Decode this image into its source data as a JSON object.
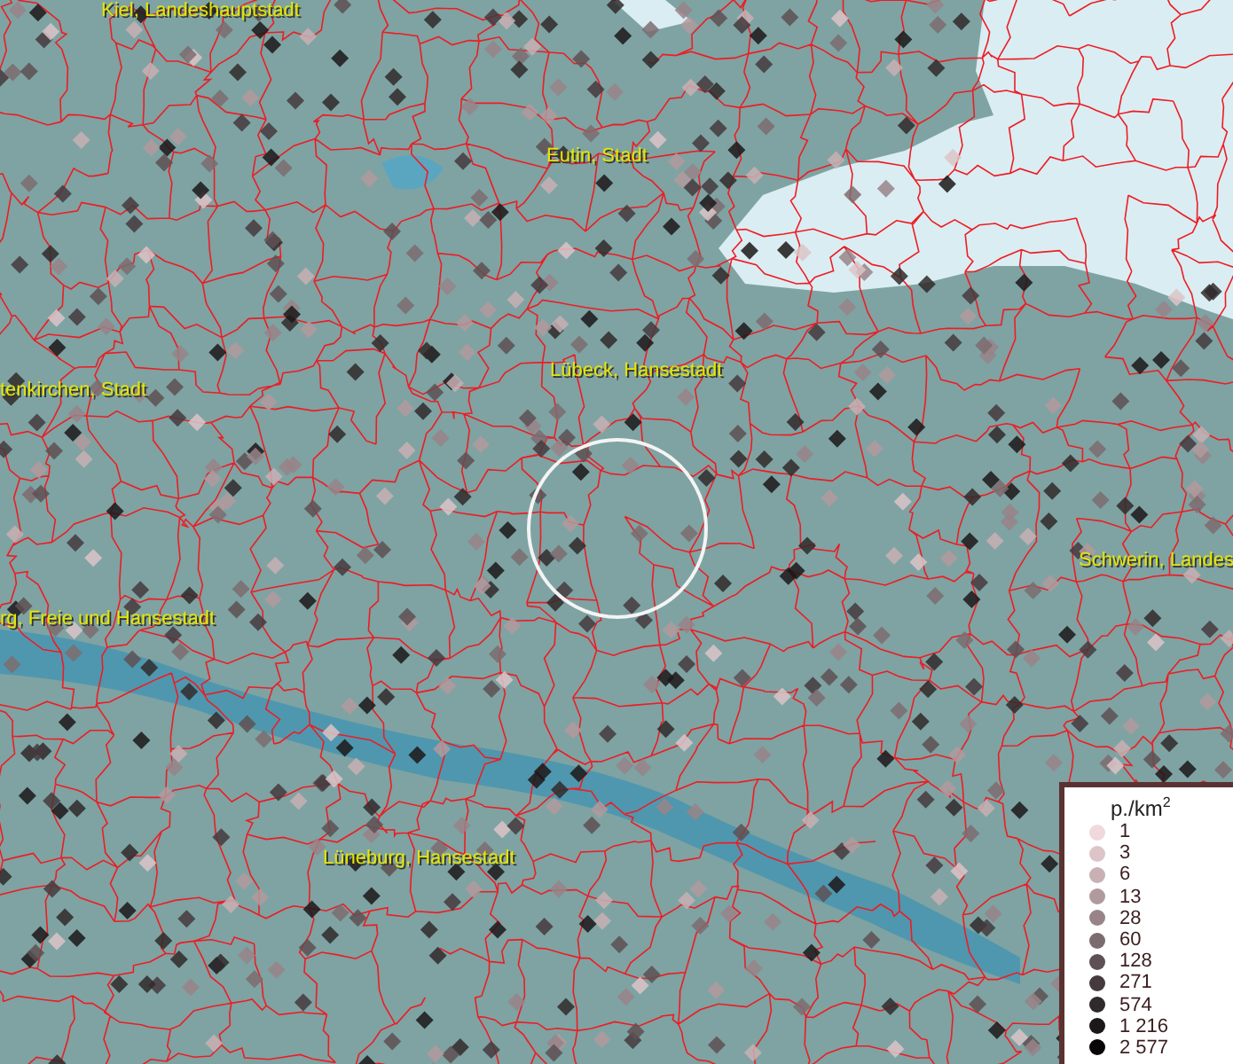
{
  "map": {
    "places": [
      {
        "name": "Kiel, Landeshauptstadt"
      },
      {
        "name": "Eutin, Stadt"
      },
      {
        "name": "tenkirchen, Stadt"
      },
      {
        "name": "Lübeck, Hansestadt"
      },
      {
        "name": "Schwerin, Landes"
      },
      {
        "name": "rg, Freie und Hansestadt"
      },
      {
        "name": "Lüneburg, Hansestadt"
      }
    ]
  },
  "legend": {
    "title": "p./km$^{2}$",
    "items": [
      {
        "label": "1",
        "color": "#f0d8dc"
      },
      {
        "label": "3",
        "color": "#dcc4c8"
      },
      {
        "label": "6",
        "color": "#c8b0b4"
      },
      {
        "label": "13",
        "color": "#b09a9e"
      },
      {
        "label": "28",
        "color": "#988488"
      },
      {
        "label": "60",
        "color": "#7c6c70"
      },
      {
        "label": "128",
        "color": "#5e5054"
      },
      {
        "label": "271",
        "color": "#453a3e"
      },
      {
        "label": "574",
        "color": "#302a2c"
      },
      {
        "label": "1 216",
        "color": "#1c1819"
      },
      {
        "label": "2 577",
        "color": "#080606"
      }
    ]
  }
}
